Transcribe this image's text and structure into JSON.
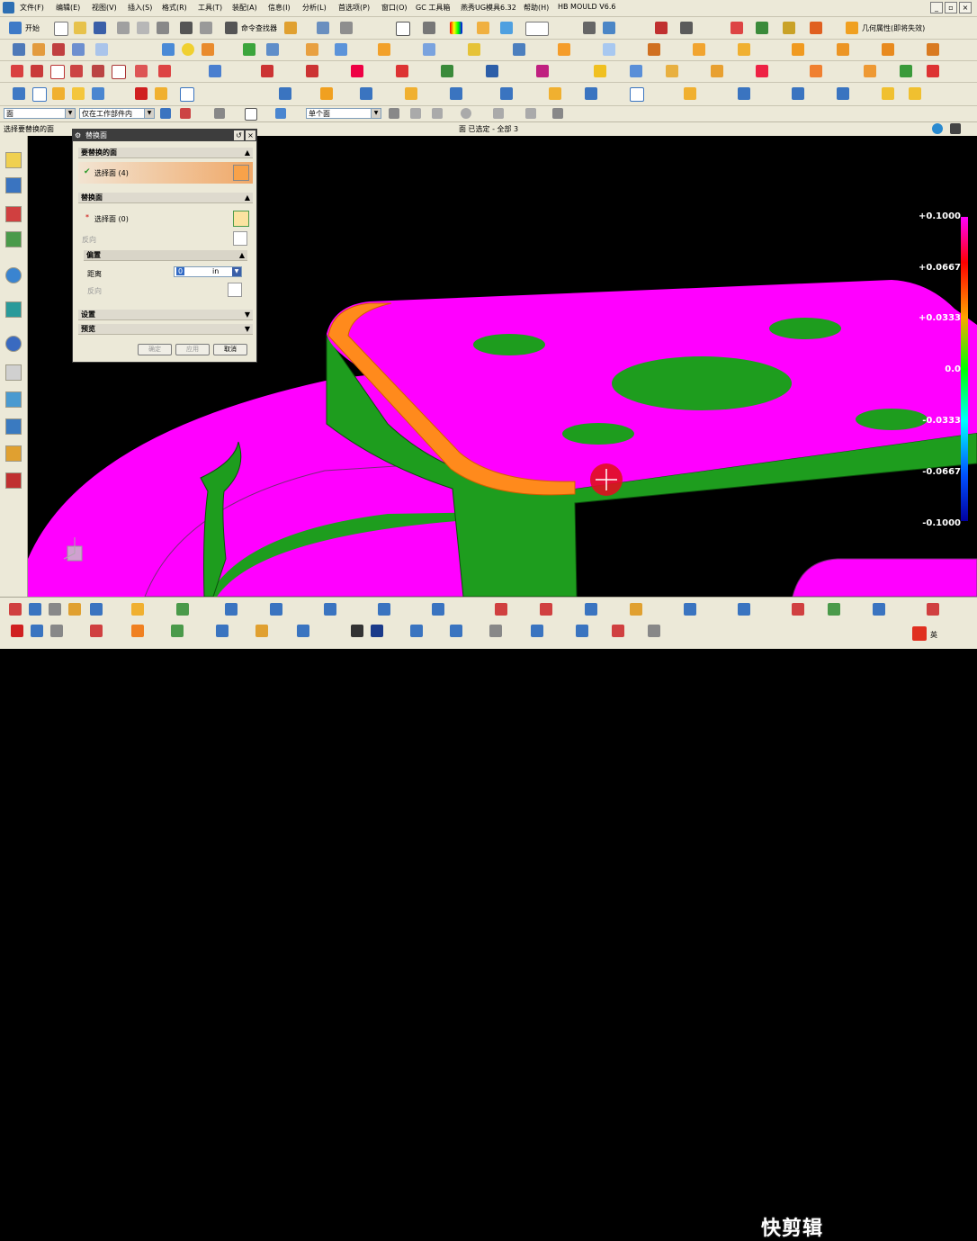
{
  "menu": [
    "文件(F)",
    "编辑(E)",
    "视图(V)",
    "插入(S)",
    "格式(R)",
    "工具(T)",
    "装配(A)",
    "信息(I)",
    "分析(L)",
    "首选项(P)",
    "窗口(O)",
    "GC 工具箱",
    "燕秀UG模具6.32",
    "帮助(H)",
    "HB MOULD V6.6"
  ],
  "toolbar1": {
    "start_label": "开始",
    "cmd_finder": "命令查找器",
    "attr_label": "几何属性(即将失效)"
  },
  "selbar": {
    "filter": "面",
    "scope": "仅在工作部件内",
    "mode": "单个面"
  },
  "status": {
    "prompt": "选择要替换的面",
    "center": "面 已选定 - 全部 3"
  },
  "dialog": {
    "title": "替换面",
    "sec1": "要替换的面",
    "sel1": "选择面 (4)",
    "sec2": "替换面",
    "sel2": "选择面 (0)",
    "dir": "反向",
    "sub": "偏置",
    "dist_label": "距离",
    "dist_value": "0",
    "dist_unit": "in",
    "dir2": "反向",
    "settings": "设置",
    "preview": "预览",
    "ok": "确定",
    "apply": "应用",
    "cancel": "取消"
  },
  "legend": [
    "+0.1000",
    "+0.0667",
    "+0.0333",
    "0.0",
    "-0.0333",
    "-0.0667",
    "-0.1000"
  ],
  "colors": {
    "magenta": "#ff00ff",
    "green": "#1e9d1e",
    "orange": "#ff8a1c"
  },
  "watermark": "快剪辑",
  "tray": "英"
}
